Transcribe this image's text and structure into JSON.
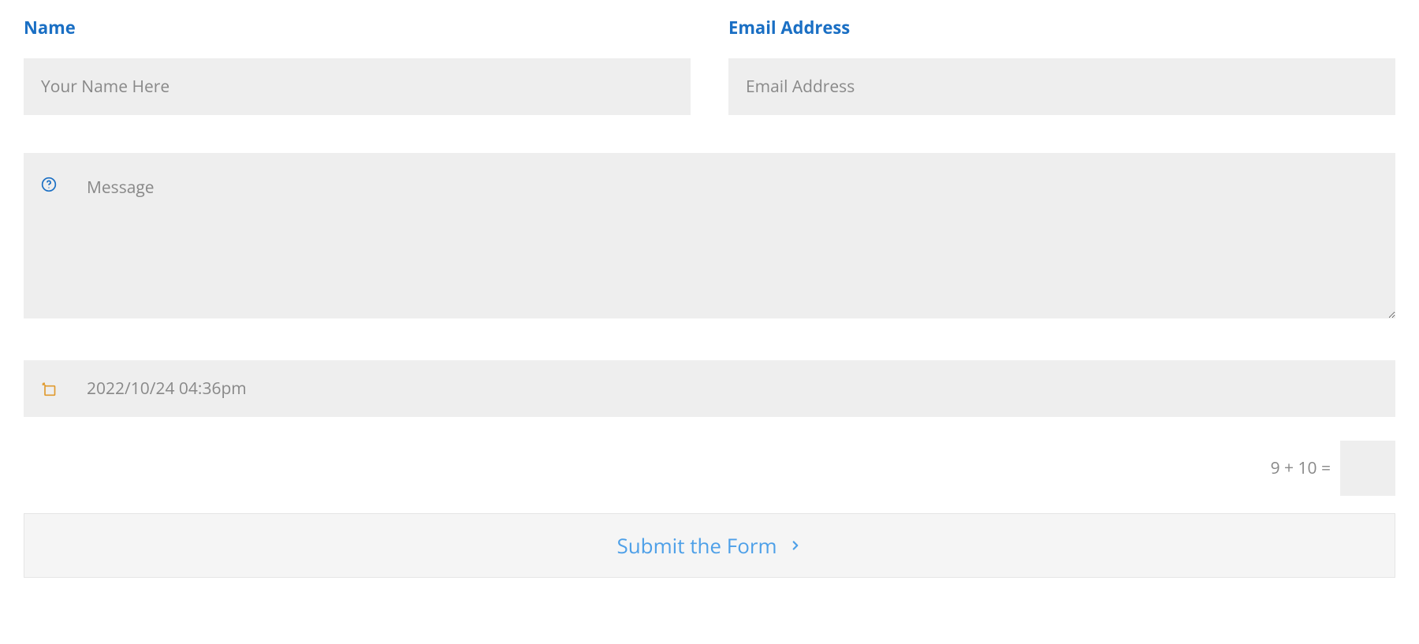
{
  "form": {
    "name": {
      "label": "Name",
      "placeholder": "Your Name Here",
      "value": ""
    },
    "email": {
      "label": "Email Address",
      "placeholder": "Email Address",
      "value": ""
    },
    "message": {
      "placeholder": "Message",
      "value": ""
    },
    "datetime": {
      "value": "2022/10/24 04:36pm"
    },
    "captcha": {
      "question": "9 + 10 =",
      "value": ""
    },
    "submit": {
      "label": "Submit the Form"
    }
  },
  "icons": {
    "help": "question-circle-icon",
    "datetime": "calendar-arrow-icon",
    "chevron": "chevron-right-icon"
  }
}
